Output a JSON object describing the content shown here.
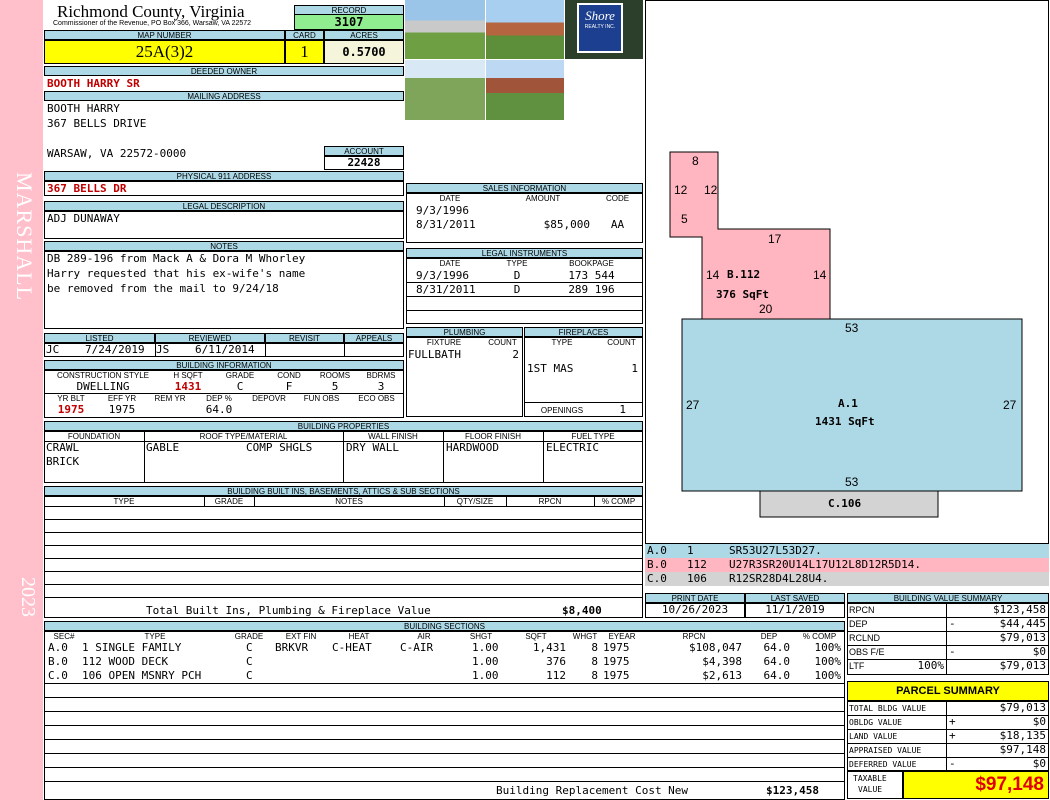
{
  "sidebar": {
    "name": "MARSHALL",
    "year": "2023"
  },
  "header": {
    "county": "Richmond County, Virginia",
    "commissioner": "Commissioner of the Revenue, PO Box 366, Warsaw, VA 22572",
    "record_label": "RECORD",
    "record": "3107"
  },
  "map": {
    "map_label": "MAP NUMBER",
    "map_number": "25A(3)2",
    "card_label": "CARD",
    "card": "1",
    "acres_label": "ACRES",
    "acres": "0.5700"
  },
  "owner": {
    "label": "DEEDED OWNER",
    "name": "BOOTH HARRY SR"
  },
  "mailing": {
    "label": "MAILING ADDRESS",
    "line1": "BOOTH HARRY",
    "line2": "367 BELLS DRIVE",
    "line3": "WARSAW, VA 22572-0000"
  },
  "account": {
    "label": "ACCOUNT",
    "value": "22428"
  },
  "physical": {
    "label": "PHYSICAL 911 ADDRESS",
    "value": "367 BELLS DR"
  },
  "legal": {
    "label": "LEGAL DESCRIPTION",
    "value": "ADJ DUNAWAY"
  },
  "notes": {
    "label": "NOTES",
    "line1": "DB 289-196 from Mack A & Dora M Whorley",
    "line2": "Harry requested that his ex-wife's name",
    "line3": "be removed from the mail to 9/24/18"
  },
  "review": {
    "listed_label": "LISTED",
    "reviewed_label": "REVIEWED",
    "revisit_label": "REVISIT",
    "appeals_label": "APPEALS",
    "listed_by": "JC",
    "listed_date": "7/24/2019",
    "reviewed_by": "JS",
    "reviewed_date": "6/11/2014"
  },
  "building_info": {
    "label": "BUILDING INFORMATION",
    "h1": [
      "CONSTRUCTION STYLE",
      "H SQFT",
      "GRADE",
      "COND",
      "ROOMS",
      "BDRMS"
    ],
    "v1": [
      "DWELLING",
      "1431",
      "C",
      "F",
      "5",
      "3"
    ],
    "h2": [
      "YR BLT",
      "EFF YR",
      "REM YR",
      "DEP %",
      "DEPOVR",
      "FUN OBS",
      "ECO OBS"
    ],
    "v2": [
      "1975",
      "1975",
      "",
      "64.0",
      "",
      "",
      ""
    ]
  },
  "sales": {
    "label": "SALES INFORMATION",
    "headers": [
      "DATE",
      "AMOUNT",
      "CODE"
    ],
    "rows": [
      [
        "9/3/1996",
        "",
        ""
      ],
      [
        "8/31/2011",
        "$85,000",
        "AA"
      ]
    ]
  },
  "instruments": {
    "label": "LEGAL INSTRUMENTS",
    "headers": [
      "DATE",
      "TYPE",
      "BOOKPAGE"
    ],
    "rows": [
      [
        "9/3/1996",
        "D",
        "173 544"
      ],
      [
        "8/31/2011",
        "D",
        "289 196"
      ]
    ]
  },
  "plumbing": {
    "label": "PLUMBING",
    "headers": [
      "FIXTURE",
      "COUNT"
    ],
    "fixture": "FULLBATH",
    "count": "2"
  },
  "fireplaces": {
    "label": "FIREPLACES",
    "headers": [
      "TYPE",
      "COUNT"
    ],
    "type": "1ST MAS",
    "count": "1",
    "openings_label": "OPENINGS",
    "openings": "1"
  },
  "properties": {
    "label": "BUILDING PROPERTIES",
    "headers": [
      "FOUNDATION",
      "ROOF TYPE/MATERIAL",
      "WALL FINISH",
      "FLOOR FINISH",
      "FUEL TYPE"
    ],
    "foundation1": "CRAWL",
    "foundation2": "BRICK",
    "roof_type": "GABLE",
    "roof_material": "COMP SHGLS",
    "wall": "DRY WALL",
    "floor": "HARDWOOD",
    "fuel": "ELECTRIC"
  },
  "builtins": {
    "label": "BUILDING BUILT INS, BASEMENTS, ATTICS & SUB SECTIONS",
    "headers": [
      "TYPE",
      "GRADE",
      "NOTES",
      "QTY/SIZE",
      "RPCN",
      "% COMP"
    ],
    "total_label": "Total Built Ins, Plumbing & Fireplace Value",
    "total": "$8,400"
  },
  "sketch": {
    "b_label": "B.112",
    "b_area": "376 SqFt",
    "a_label": "A.1",
    "a_area": "1431 SqFt",
    "c_label": "C.106",
    "dims": {
      "b_top": "8",
      "b_12a": "12",
      "b_12b": "12",
      "b_5": "5",
      "b_17": "17",
      "b_14a": "14",
      "b_14b": "14",
      "b_20": "20",
      "a_53t": "53",
      "a_27l": "27",
      "a_27r": "27",
      "a_53b": "53"
    },
    "colors": {
      "b": "#ffb6c1",
      "a": "#add8e6",
      "c": "#d3d3d3"
    }
  },
  "legend": [
    {
      "code": "A.0",
      "num": "1",
      "desc": "SR53U27L53D27.",
      "color": "#add8e6"
    },
    {
      "code": "B.0",
      "num": "112",
      "desc": "U27R3SR20U14L17U12L8D12R5D14.",
      "color": "#ffb6c1"
    },
    {
      "code": "C.0",
      "num": "106",
      "desc": "R12SR28D4L28U4.",
      "color": "#d3d3d3"
    }
  ],
  "print": {
    "print_label": "PRINT DATE",
    "saved_label": "LAST SAVED",
    "print_date": "10/26/2023",
    "last_saved": "11/1/2019"
  },
  "sections": {
    "label": "BUILDING SECTIONS",
    "headers": [
      "SEC#",
      "TYPE",
      "GRADE",
      "EXT FIN",
      "HEAT",
      "AIR",
      "SHGT",
      "SQFT",
      "WHGT",
      "EYEAR",
      "RPCN",
      "DEP",
      "% COMP"
    ],
    "rows": [
      [
        "A.0",
        "1 SINGLE FAMILY",
        "C",
        "BRKVR",
        "C-HEAT",
        "C-AIR",
        "1.00",
        "1,431",
        "8",
        "1975",
        "$108,047",
        "64.0",
        "100%"
      ],
      [
        "B.0",
        "112 WOOD DECK",
        "C",
        "",
        "",
        "",
        "1.00",
        "376",
        "8",
        "1975",
        "$4,398",
        "64.0",
        "100%"
      ],
      [
        "C.0",
        "106 OPEN MSNRY PCH",
        "C",
        "",
        "",
        "",
        "1.00",
        "112",
        "8",
        "1975",
        "$2,613",
        "64.0",
        "100%"
      ]
    ],
    "total_label": "Building Replacement Cost New",
    "total": "$123,458"
  },
  "value_summary": {
    "label": "BUILDING VALUE SUMMARY",
    "rows": [
      {
        "label": "RPCN",
        "sign": "",
        "pct": "",
        "value": "$123,458"
      },
      {
        "label": "DEP",
        "sign": "-",
        "pct": "",
        "value": "$44,445"
      },
      {
        "label": "RCLND",
        "sign": "",
        "pct": "",
        "value": "$79,013"
      },
      {
        "label": "OBS F/E",
        "sign": "-",
        "pct": "",
        "value": "$0"
      },
      {
        "label": "LTF",
        "sign": "",
        "pct": "100%",
        "value": "$79,013"
      }
    ]
  },
  "parcel": {
    "label": "PARCEL SUMMARY",
    "rows": [
      {
        "label": "TOTAL BLDG VALUE",
        "sign": "",
        "value": "$79,013"
      },
      {
        "label": "OBLDG VALUE",
        "sign": "+",
        "value": "$0"
      },
      {
        "label": "LAND VALUE",
        "sign": "+",
        "value": "$18,135"
      },
      {
        "label": "APPRAISED VALUE",
        "sign": "",
        "value": "$97,148"
      },
      {
        "label": "DEFERRED VALUE",
        "sign": "-",
        "value": "$0"
      }
    ],
    "taxable_label1": "TAXABLE",
    "taxable_label2": "VALUE",
    "taxable": "$97,148"
  },
  "logo": {
    "line1": "Shore",
    "line2": "REALTY INC."
  }
}
